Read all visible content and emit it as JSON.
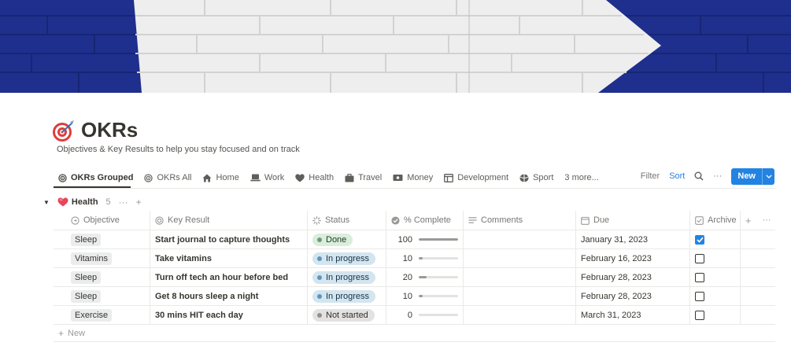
{
  "page": {
    "title": "OKRs",
    "description": "Objectives & Key Results to help you stay focused and on track",
    "icon": "target-dart-icon"
  },
  "tabs": [
    {
      "label": "OKRs Grouped",
      "icon": "target-icon",
      "active": true
    },
    {
      "label": "OKRs All",
      "icon": "target-icon"
    },
    {
      "label": "Home",
      "icon": "house-icon"
    },
    {
      "label": "Work",
      "icon": "laptop-icon"
    },
    {
      "label": "Health",
      "icon": "heart-icon"
    },
    {
      "label": "Travel",
      "icon": "suitcase-icon"
    },
    {
      "label": "Money",
      "icon": "money-icon"
    },
    {
      "label": "Development",
      "icon": "board-icon"
    },
    {
      "label": "Sport",
      "icon": "ball-icon"
    },
    {
      "label": "3 more..."
    }
  ],
  "toolbar": {
    "filter": "Filter",
    "sort": "Sort",
    "more": "···",
    "new": "New"
  },
  "group": {
    "name": "Health",
    "count": "5",
    "more": "···",
    "add": "+"
  },
  "columns": {
    "objective": "Objective",
    "key_result": "Key Result",
    "status": "Status",
    "percent": "% Complete",
    "comments": "Comments",
    "due": "Due",
    "archive": "Archive",
    "add": "+",
    "more": "···"
  },
  "rows": [
    {
      "objective": "Sleep",
      "key_result": "Start journal to capture thoughts",
      "status": "Done",
      "status_kind": "done",
      "percent": 100,
      "percent_label": "100",
      "comments": "",
      "due": "January 31, 2023",
      "archive": true
    },
    {
      "objective": "Vitamins",
      "key_result": "Take vitamins",
      "status": "In progress",
      "status_kind": "progress",
      "percent": 10,
      "percent_label": "10",
      "comments": "",
      "due": "February 16, 2023",
      "archive": false
    },
    {
      "objective": "Sleep",
      "key_result": "Turn off tech an hour before bed",
      "status": "In progress",
      "status_kind": "progress",
      "percent": 20,
      "percent_label": "20",
      "comments": "",
      "due": "February 28, 2023",
      "archive": false
    },
    {
      "objective": "Sleep",
      "key_result": "Get 8 hours sleep a night",
      "status": "In progress",
      "status_kind": "progress",
      "percent": 10,
      "percent_label": "10",
      "comments": "",
      "due": "February 28, 2023",
      "archive": false
    },
    {
      "objective": "Exercise",
      "key_result": "30 mins HIT each day",
      "status": "Not started",
      "status_kind": "notstarted",
      "percent": 0,
      "percent_label": "0",
      "comments": "",
      "due": "March 31, 2023",
      "archive": false
    }
  ],
  "new_row": "New",
  "colors": {
    "accent": "#2383e2",
    "cover_blue": "#1e2f8c",
    "done": "#dbeddb",
    "in_progress": "#d3e5ef",
    "not_started": "#e3e2e0"
  }
}
